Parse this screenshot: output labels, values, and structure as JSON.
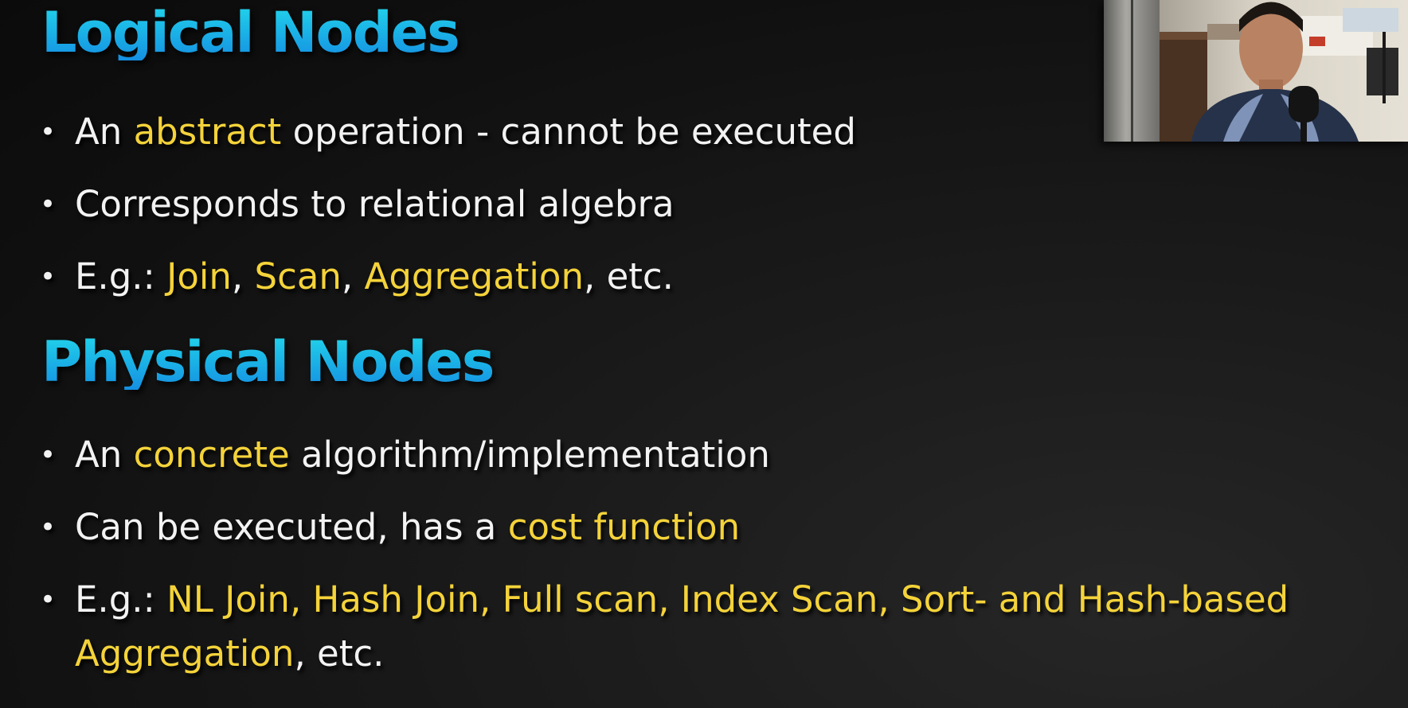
{
  "logical": {
    "title": "Logical Nodes",
    "b1": {
      "p1": "An ",
      "h1": "abstract",
      "p2": " operation - cannot be executed"
    },
    "b2": {
      "p1": "Corresponds to relational algebra"
    },
    "b3": {
      "p1": "E.g.: ",
      "h1": "Join",
      "p2": ", ",
      "h2": "Scan",
      "p3": ", ",
      "h3": "Aggregation",
      "p4": ", etc."
    }
  },
  "physical": {
    "title": "Physical Nodes",
    "b1": {
      "p1": "An ",
      "h1": "concrete",
      "p2": " algorithm/implementation"
    },
    "b2": {
      "p1": "Can be executed, has a ",
      "h1": "cost function"
    },
    "b3": {
      "p1": "E.g.: ",
      "h1": "NL Join, Hash Join, Full scan, Index Scan, Sort- and Hash-based Aggregation",
      "p2": ", etc."
    }
  },
  "bullet_glyph": "•",
  "colors": {
    "heading": "#1ab4e8",
    "highlight": "#f4d23a",
    "text": "#f2f2f2",
    "background": "#141414"
  },
  "webcam": {
    "icon": "presenter-video"
  }
}
